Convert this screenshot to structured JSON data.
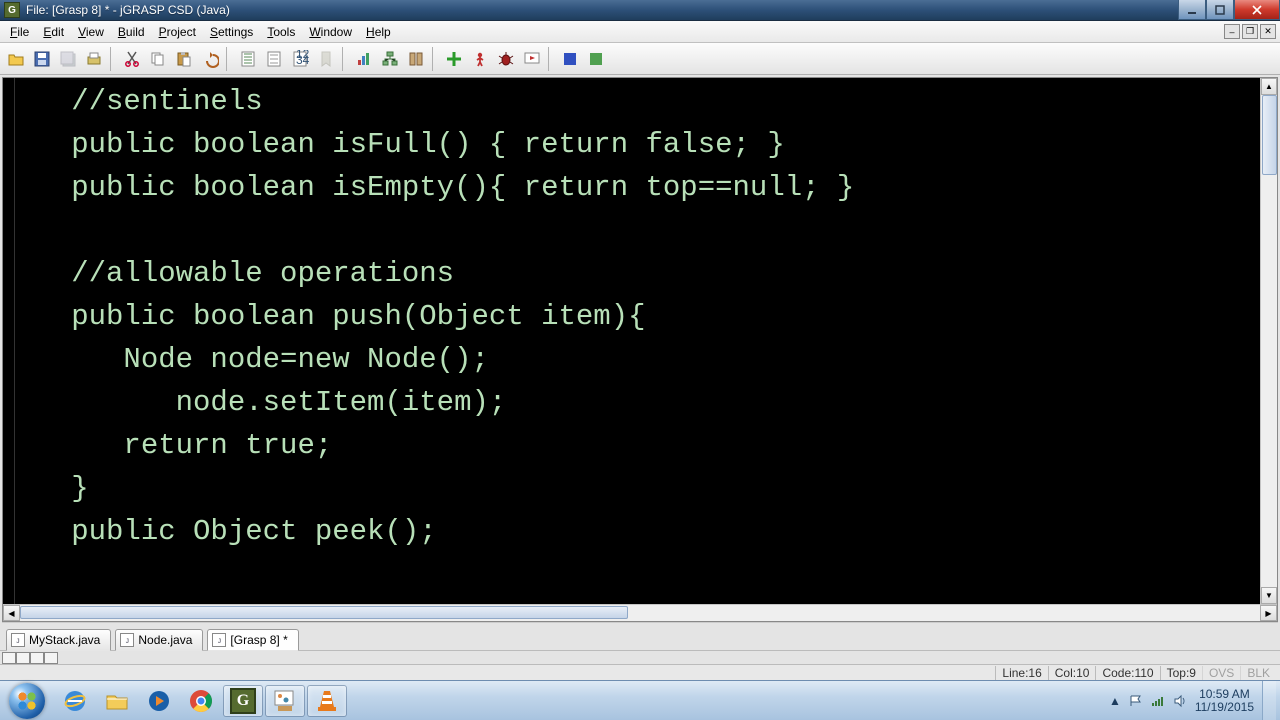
{
  "window": {
    "title": "File: [Grasp 8] * - jGRASP CSD (Java)",
    "app_icon_letter": "G"
  },
  "menu": {
    "items": [
      "File",
      "Edit",
      "View",
      "Build",
      "Project",
      "Settings",
      "Tools",
      "Window",
      "Help"
    ]
  },
  "toolbar_icons": [
    "open-icon",
    "save-icon",
    "save-all-icon",
    "print-icon",
    "cut-icon",
    "copy-icon",
    "paste-icon",
    "undo-icon",
    "csd-icon",
    "remove-csd-icon",
    "number-csd-icon",
    "bookmark-icon",
    "barchart-icon",
    "uml-icon",
    "book-icon",
    "compile-icon",
    "run-icon",
    "debug-icon",
    "run-debug-icon",
    "blue-box-icon",
    "green-box-icon"
  ],
  "code_lines": [
    "   //sentinels",
    "   public boolean isFull() { return false; }",
    "   public boolean isEmpty(){ return top==null; }",
    "",
    "   //allowable operations",
    "   public boolean push(Object item){",
    "      Node node=new Node();",
    "         node.setItem(item);",
    "      return true;",
    "   }",
    "   public Object peek();"
  ],
  "tabs": [
    {
      "label": "MyStack.java",
      "active": false
    },
    {
      "label": "Node.java",
      "active": false
    },
    {
      "label": "[Grasp 8] *",
      "active": true
    }
  ],
  "status": {
    "line": "Line:16",
    "col": "Col:10",
    "code": "Code:110",
    "top": "Top:9",
    "ovs": "OVS",
    "blk": "BLK"
  },
  "taskbar": {
    "apps": [
      {
        "name": "ie-icon"
      },
      {
        "name": "explorer-icon"
      },
      {
        "name": "wmp-icon"
      },
      {
        "name": "chrome-icon"
      },
      {
        "name": "jgrasp-icon",
        "running": true
      },
      {
        "name": "paint-icon",
        "running": true
      },
      {
        "name": "vlc-icon",
        "running": true
      }
    ],
    "tray_icons": [
      "flag-icon",
      "network-icon",
      "volume-icon"
    ],
    "time": "10:59 AM",
    "date": "11/19/2015"
  }
}
